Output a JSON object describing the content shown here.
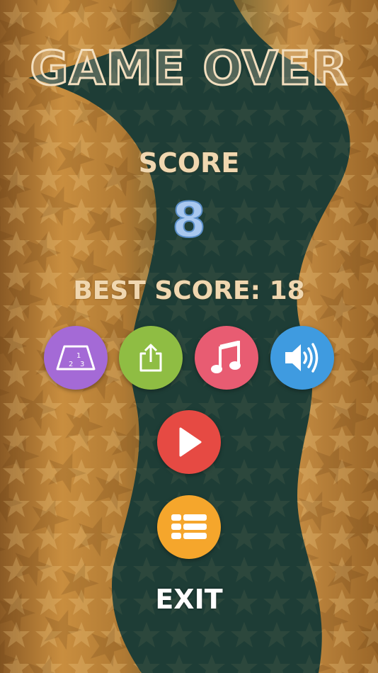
{
  "screen": {
    "title": "GAME OVER",
    "score_label": "SCORE",
    "score_value": "8",
    "best_score_label": "BEST SCORE: 18",
    "exit_label": "EXIT"
  },
  "buttons": [
    {
      "name": "levels-button",
      "icon": "level-select-icon",
      "color": "#a46ad6",
      "text_a": "1",
      "text_b": "2",
      "text_c": "3"
    },
    {
      "name": "share-button",
      "icon": "share-icon",
      "color": "#8fbd43"
    },
    {
      "name": "music-button",
      "icon": "music-note-icon",
      "color": "#e85c72"
    },
    {
      "name": "sound-button",
      "icon": "speaker-icon",
      "color": "#3f9be0"
    },
    {
      "name": "play-button",
      "icon": "play-icon",
      "color": "#e64a43"
    },
    {
      "name": "menu-button",
      "icon": "menu-grid-icon",
      "color": "#f5a62c"
    }
  ],
  "colors": {
    "background_dark": "#1e3d36",
    "background_gold": "#c48a3c",
    "title": "#f3dfbf",
    "score_value": "#a9c8ef"
  }
}
